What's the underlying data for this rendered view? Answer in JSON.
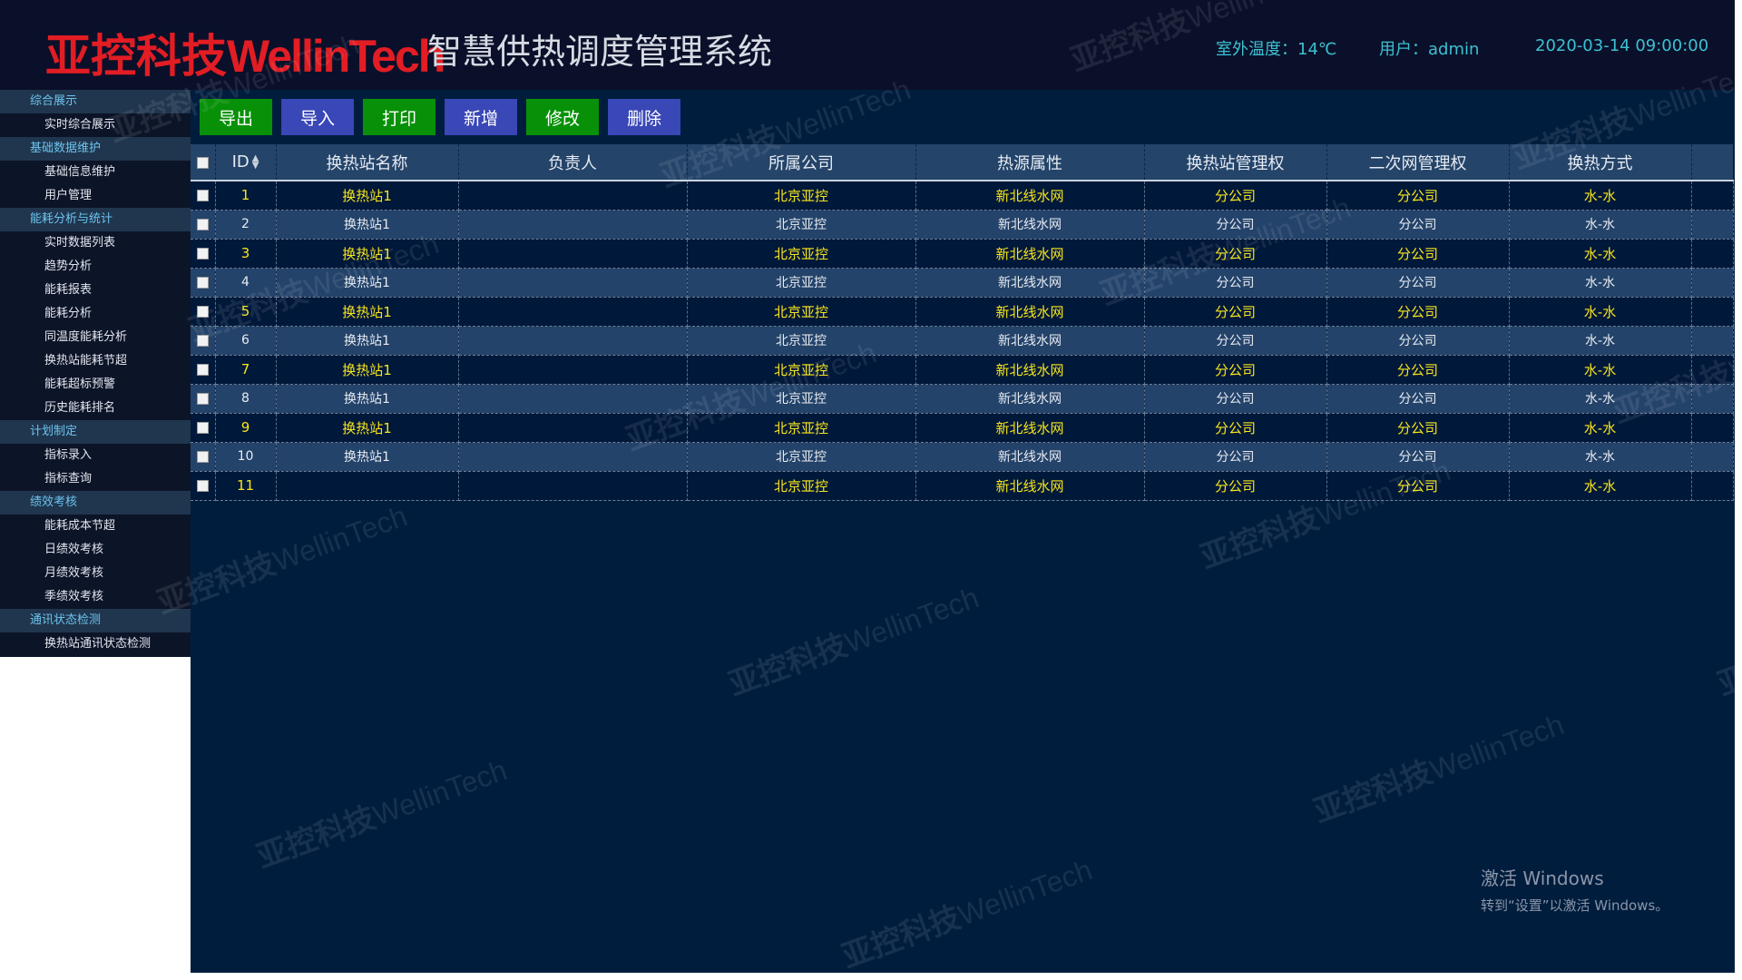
{
  "header": {
    "logo_cn": "亚控科技",
    "logo_en": "WellinTech",
    "title": "智慧供热调度管理系统",
    "temperature": "室外温度：14℃",
    "user": "用户：admin",
    "datetime": "2020-03-14 09:00:00"
  },
  "sidebar": {
    "groups": [
      {
        "label": "综合展示",
        "items": [
          "实时综合展示"
        ]
      },
      {
        "label": "基础数据维护",
        "items": [
          "基础信息维护",
          "用户管理"
        ]
      },
      {
        "label": "能耗分析与统计",
        "items": [
          "实时数据列表",
          "趋势分析",
          "能耗报表",
          "能耗分析",
          "同温度能耗分析",
          "换热站能耗节超",
          "能耗超标预警",
          "历史能耗排名"
        ]
      },
      {
        "label": "计划制定",
        "items": [
          "指标录入",
          "指标查询"
        ]
      },
      {
        "label": "绩效考核",
        "items": [
          "能耗成本节超",
          "日绩效考核",
          "月绩效考核",
          "季绩效考核"
        ]
      },
      {
        "label": "通讯状态检测",
        "items": [
          "换热站通讯状态检测"
        ]
      }
    ]
  },
  "toolbar": {
    "export": "导出",
    "import": "导入",
    "print": "打印",
    "add": "新增",
    "edit": "修改",
    "delete": "删除"
  },
  "table": {
    "columns": [
      "ID",
      "换热站名称",
      "负责人",
      "所属公司",
      "热源属性",
      "换热站管理权",
      "二次网管理权",
      "换热方式"
    ],
    "rows": [
      {
        "id": "1",
        "name": "换热站1",
        "owner": "",
        "company": "北京亚控",
        "source": "新北线水网",
        "station_mgmt": "分公司",
        "network_mgmt": "分公司",
        "mode": "水-水"
      },
      {
        "id": "2",
        "name": "换热站1",
        "owner": "",
        "company": "北京亚控",
        "source": "新北线水网",
        "station_mgmt": "分公司",
        "network_mgmt": "分公司",
        "mode": "水-水"
      },
      {
        "id": "3",
        "name": "换热站1",
        "owner": "",
        "company": "北京亚控",
        "source": "新北线水网",
        "station_mgmt": "分公司",
        "network_mgmt": "分公司",
        "mode": "水-水"
      },
      {
        "id": "4",
        "name": "换热站1",
        "owner": "",
        "company": "北京亚控",
        "source": "新北线水网",
        "station_mgmt": "分公司",
        "network_mgmt": "分公司",
        "mode": "水-水"
      },
      {
        "id": "5",
        "name": "换热站1",
        "owner": "",
        "company": "北京亚控",
        "source": "新北线水网",
        "station_mgmt": "分公司",
        "network_mgmt": "分公司",
        "mode": "水-水"
      },
      {
        "id": "6",
        "name": "换热站1",
        "owner": "",
        "company": "北京亚控",
        "source": "新北线水网",
        "station_mgmt": "分公司",
        "network_mgmt": "分公司",
        "mode": "水-水"
      },
      {
        "id": "7",
        "name": "换热站1",
        "owner": "",
        "company": "北京亚控",
        "source": "新北线水网",
        "station_mgmt": "分公司",
        "network_mgmt": "分公司",
        "mode": "水-水"
      },
      {
        "id": "8",
        "name": "换热站1",
        "owner": "",
        "company": "北京亚控",
        "source": "新北线水网",
        "station_mgmt": "分公司",
        "network_mgmt": "分公司",
        "mode": "水-水"
      },
      {
        "id": "9",
        "name": "换热站1",
        "owner": "",
        "company": "北京亚控",
        "source": "新北线水网",
        "station_mgmt": "分公司",
        "network_mgmt": "分公司",
        "mode": "水-水"
      },
      {
        "id": "10",
        "name": "换热站1",
        "owner": "",
        "company": "北京亚控",
        "source": "新北线水网",
        "station_mgmt": "分公司",
        "network_mgmt": "分公司",
        "mode": "水-水"
      },
      {
        "id": "11",
        "name": "",
        "owner": "",
        "company": "北京亚控",
        "source": "新北线水网",
        "station_mgmt": "分公司",
        "network_mgmt": "分公司",
        "mode": "水-水"
      }
    ]
  },
  "watermark": {
    "cn": "亚控科技",
    "en": "WellinTech"
  },
  "windows_activation": {
    "title": "激活 Windows",
    "subtitle": "转到“设置”以激活 Windows。"
  },
  "colors": {
    "header_bg": "#0a1029",
    "main_bg": "#001d3e",
    "logo_red": "#e21d24",
    "highlight_yellow": "#f7e61b",
    "info_cyan": "#3dc0d3",
    "button_green": "#089108",
    "button_blue": "#3947b7"
  }
}
